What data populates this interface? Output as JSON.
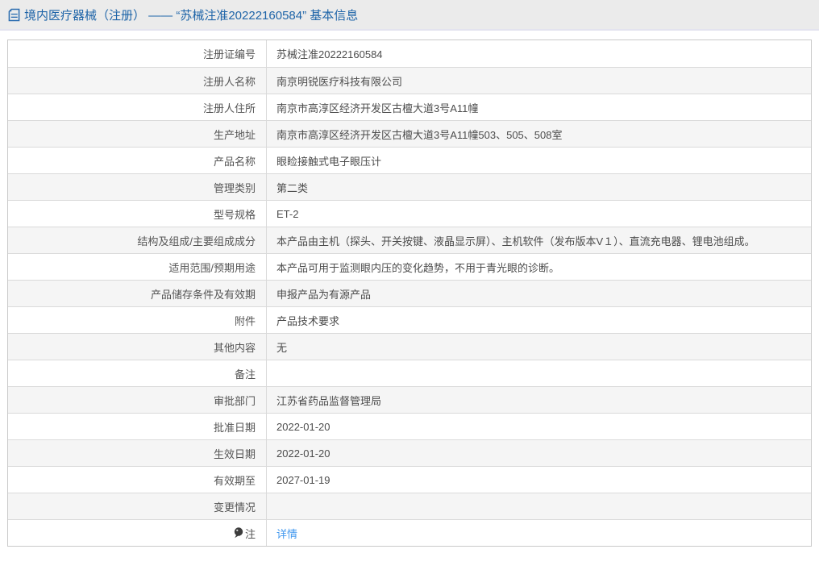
{
  "header": {
    "icon": "document-icon",
    "title": "境内医疗器械（注册） —— “苏械注准20222160584” 基本信息"
  },
  "table": {
    "rows": [
      {
        "label": "注册证编号",
        "value": "苏械注准20222160584"
      },
      {
        "label": "注册人名称",
        "value": "南京明锐医疗科技有限公司"
      },
      {
        "label": "注册人住所",
        "value": "南京市高淳区经济开发区古檀大道3号A11幢"
      },
      {
        "label": "生产地址",
        "value": "南京市高淳区经济开发区古檀大道3号A11幢503、505、508室"
      },
      {
        "label": "产品名称",
        "value": "眼睑接触式电子眼压计"
      },
      {
        "label": "管理类别",
        "value": "第二类"
      },
      {
        "label": "型号规格",
        "value": "ET-2"
      },
      {
        "label": "结构及组成/主要组成成分",
        "value": "本产品由主机（探头、开关按键、液晶显示屏）、主机软件（发布版本V１）、直流充电器、锂电池组成。"
      },
      {
        "label": "适用范围/预期用途",
        "value": "本产品可用于监测眼内压的变化趋势，不用于青光眼的诊断。"
      },
      {
        "label": "产品储存条件及有效期",
        "value": "申报产品为有源产品"
      },
      {
        "label": "附件",
        "value": "产品技术要求"
      },
      {
        "label": "其他内容",
        "value": "无"
      },
      {
        "label": "备注",
        "value": ""
      },
      {
        "label": "审批部门",
        "value": "江苏省药品监督管理局"
      },
      {
        "label": "批准日期",
        "value": "2022-01-20"
      },
      {
        "label": "生效日期",
        "value": "2022-01-20"
      },
      {
        "label": "有效期至",
        "value": "2027-01-19"
      },
      {
        "label": "变更情况",
        "value": ""
      },
      {
        "label": "注",
        "value": "详情",
        "value_is_link": true,
        "icon": "note-icon"
      }
    ]
  },
  "colors": {
    "header_bg": "#ebebeb",
    "title_text": "#1e64a8",
    "row_alt_bg": "#f5f5f5",
    "table_border": "#c9c9c9",
    "inner_border": "#dadada",
    "label_text": "#545454",
    "value_text": "#4c4c4c",
    "link": "#4298ef"
  }
}
